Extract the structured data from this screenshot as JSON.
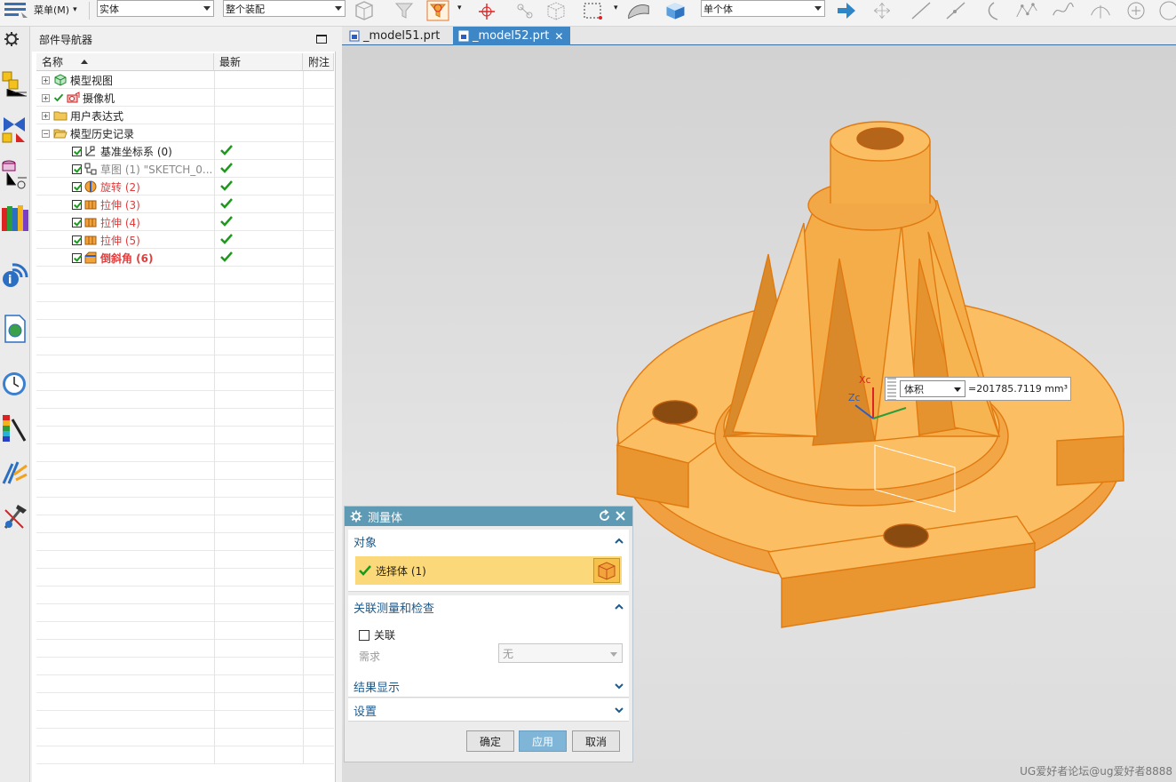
{
  "toolbar": {
    "menu_label": "菜单(M)",
    "filter_type": "实体",
    "selection_scope": "整个装配",
    "body_filter": "单个体"
  },
  "resource_bar": {
    "icons": [
      "gear-icon",
      "assembly-navigator-icon",
      "constraint-navigator-icon",
      "part-navigator-icon",
      "reuse-library-icon",
      "info-icon",
      "web-browser-icon",
      "history-icon",
      "color-palette-icon",
      "roles-icon",
      "tools-icon"
    ]
  },
  "navigator": {
    "title": "部件导航器",
    "columns": {
      "name": "名称",
      "latest": "最新",
      "note": "附注"
    },
    "items": [
      {
        "label": "模型视图",
        "style": "normal",
        "latest": false
      },
      {
        "label": "摄像机",
        "style": "normal",
        "latest": false
      },
      {
        "label": "用户表达式",
        "style": "normal",
        "latest": false
      },
      {
        "label": "模型历史记录",
        "style": "normal",
        "latest": false
      },
      {
        "label": "基准坐标系 (0)",
        "style": "normal",
        "latest": true
      },
      {
        "label": "草图 (1) \"SKETCH_0...",
        "style": "dim",
        "latest": true
      },
      {
        "label": "旋转 (2)",
        "style": "red",
        "latest": true
      },
      {
        "label": "拉伸 (3)",
        "style": "red",
        "latest": true
      },
      {
        "label": "拉伸 (4)",
        "style": "red",
        "latest": true
      },
      {
        "label": "拉伸 (5)",
        "style": "red",
        "latest": true
      },
      {
        "label": "倒斜角 (6)",
        "style": "red-bold",
        "latest": true
      }
    ]
  },
  "graphics": {
    "tabs": [
      {
        "label": "_model51.prt",
        "active": false
      },
      {
        "label": "_model52.prt",
        "active": true
      }
    ],
    "triad": {
      "xc": "Xc",
      "zc": "Zc"
    },
    "measure_readout": {
      "type": "体积",
      "value": "=201785.7119 mm³"
    },
    "watermark": "UG爱好者论坛@ug爱好者8888",
    "part_color": "#f7a83a"
  },
  "dialog": {
    "title": "测量体",
    "groups": {
      "object": "对象",
      "associative": "关联测量和检查",
      "results": "结果显示",
      "settings": "设置"
    },
    "select_body": "选择体 (1)",
    "associative_label": "关联",
    "requirement_label": "需求",
    "requirement_value": "无",
    "buttons": {
      "ok": "确定",
      "apply": "应用",
      "cancel": "取消"
    },
    "accent": "#5e9ab4"
  }
}
